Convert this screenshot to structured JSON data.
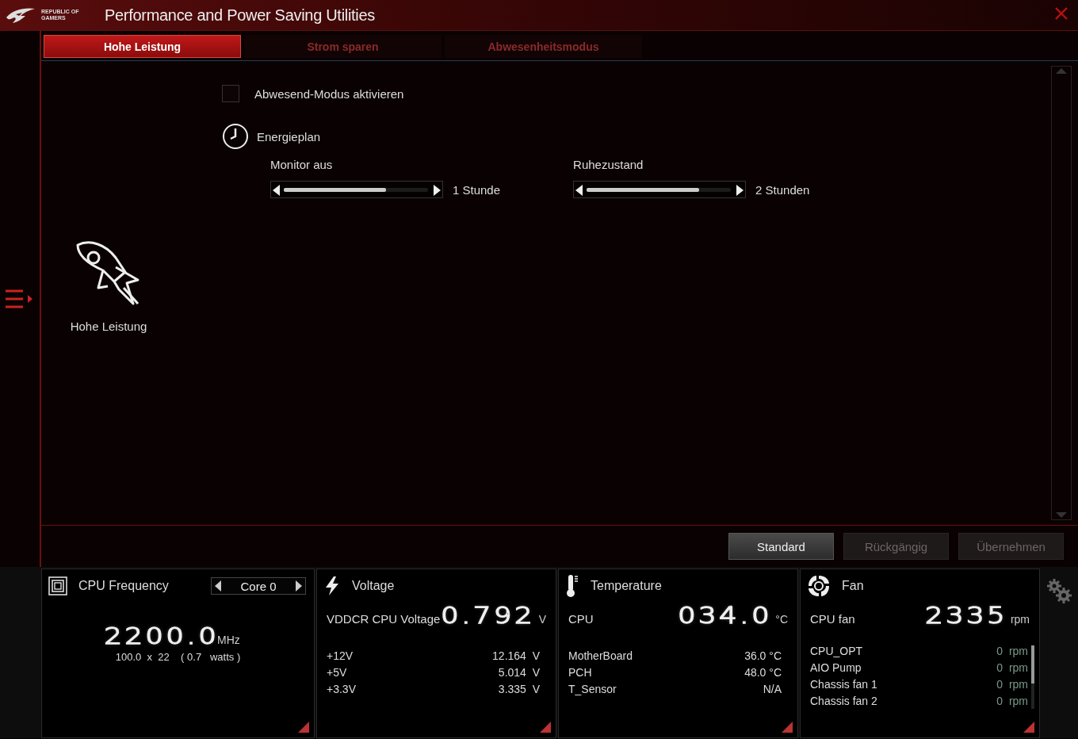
{
  "window": {
    "title": "Performance and Power Saving Utilities",
    "logo_text": [
      "REPUBLIC OF",
      "GAMERS"
    ]
  },
  "tabs": [
    {
      "label": "Hohe Leistung",
      "selected": true
    },
    {
      "label": "Strom sparen",
      "selected": false
    },
    {
      "label": "Abwesenheitsmodus",
      "selected": false
    }
  ],
  "mode": {
    "label": "Hohe Leistung"
  },
  "away_mode": {
    "label": "Abwesend-Modus aktivieren",
    "checked": false
  },
  "power_plan": {
    "title": "Energieplan",
    "settings": [
      {
        "label": "Monitor aus",
        "level": 0.71,
        "reading": "1 Stunde"
      },
      {
        "label": "Ruhezustand",
        "level": 0.78,
        "reading": "2 Stunden"
      }
    ]
  },
  "buttons": [
    {
      "label": "Standard",
      "disabled": false
    },
    {
      "label": "Rückgängig",
      "disabled": true
    },
    {
      "label": "Übernehmen",
      "disabled": true
    }
  ],
  "monitors": [
    {
      "kind": "frequency",
      "title": "CPU Frequency",
      "selector": "Core 0",
      "value": "2200.0",
      "unit": "MHz",
      "detail": "100.0  x  22    ( 0.7   watts )"
    },
    {
      "kind": "voltage",
      "title": "Voltage",
      "main_label": "VDDCR CPU Voltage",
      "value": "0.792",
      "unit": "V",
      "rows": [
        {
          "label": "+12V",
          "value": "12.164  V"
        },
        {
          "label": "+5V",
          "value": "5.014  V"
        },
        {
          "label": "+3.3V",
          "value": "3.335  V"
        }
      ]
    },
    {
      "kind": "temperature",
      "title": "Temperature",
      "main_label": "CPU",
      "value": "034.0",
      "unit": "°C",
      "rows": [
        {
          "label": "MotherBoard",
          "value": "36.0 °C"
        },
        {
          "label": "PCH",
          "value": "48.0 °C"
        },
        {
          "label": "T_Sensor",
          "value": "N/A"
        }
      ]
    },
    {
      "kind": "fan",
      "title": "Fan",
      "main_label": "CPU fan",
      "value": "2335",
      "unit": "rpm",
      "rows": [
        {
          "label": "CPU_OPT",
          "value": "0  rpm"
        },
        {
          "label": "AIO Pump",
          "value": "0  rpm"
        },
        {
          "label": "Chassis fan 1",
          "value": "0  rpm"
        },
        {
          "label": "Chassis fan 2",
          "value": "0  rpm"
        }
      ]
    }
  ]
}
